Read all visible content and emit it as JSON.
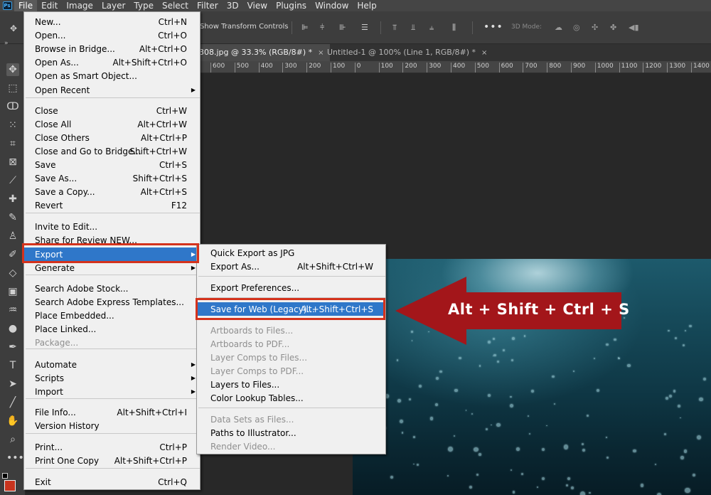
{
  "menubar": {
    "app_logo": "Ps",
    "items": [
      "File",
      "Edit",
      "Image",
      "Layer",
      "Type",
      "Select",
      "Filter",
      "3D",
      "View",
      "Plugins",
      "Window",
      "Help"
    ]
  },
  "options_bar": {
    "transform_label": "Show Transform Controls",
    "mode_3d_label": "3D Mode:",
    "more_label": "•••"
  },
  "tabs": [
    {
      "label": "308.jpg @ 33.3% (RGB/8#) *",
      "close": "×"
    },
    {
      "label": "Untitled-1 @ 100% (Line 1, RGB/8#) *",
      "close": "×"
    }
  ],
  "ruler": {
    "ticks": [
      "600",
      "500",
      "400",
      "300",
      "200",
      "100",
      "0",
      "100",
      "200",
      "300",
      "400",
      "500",
      "600",
      "700",
      "800",
      "900",
      "1000",
      "1100",
      "1200",
      "1300",
      "1400"
    ]
  },
  "file_menu": {
    "items": [
      {
        "label": "New...",
        "shortcut": "Ctrl+N"
      },
      {
        "label": "Open...",
        "shortcut": "Ctrl+O"
      },
      {
        "label": "Browse in Bridge...",
        "shortcut": "Alt+Ctrl+O"
      },
      {
        "label": "Open As...",
        "shortcut": "Alt+Shift+Ctrl+O"
      },
      {
        "label": "Open as Smart Object...",
        "shortcut": ""
      },
      {
        "label": "Open Recent",
        "shortcut": "",
        "submenu": true
      },
      {
        "label": "Close",
        "shortcut": "Ctrl+W"
      },
      {
        "label": "Close All",
        "shortcut": "Alt+Ctrl+W"
      },
      {
        "label": "Close Others",
        "shortcut": "Alt+Ctrl+P"
      },
      {
        "label": "Close and Go to Bridge...",
        "shortcut": "Shift+Ctrl+W"
      },
      {
        "label": "Save",
        "shortcut": "Ctrl+S"
      },
      {
        "label": "Save As...",
        "shortcut": "Shift+Ctrl+S"
      },
      {
        "label": "Save a Copy...",
        "shortcut": "Alt+Ctrl+S"
      },
      {
        "label": "Revert",
        "shortcut": "F12"
      },
      {
        "label": "Invite to Edit...",
        "shortcut": ""
      },
      {
        "label": "Share for Review NEW...",
        "shortcut": ""
      },
      {
        "label": "Export",
        "shortcut": "",
        "submenu": true,
        "highlighted": true
      },
      {
        "label": "Generate",
        "shortcut": "",
        "submenu": true
      },
      {
        "label": "Search Adobe Stock...",
        "shortcut": ""
      },
      {
        "label": "Search Adobe Express Templates...",
        "shortcut": ""
      },
      {
        "label": "Place Embedded...",
        "shortcut": ""
      },
      {
        "label": "Place Linked...",
        "shortcut": ""
      },
      {
        "label": "Package...",
        "shortcut": "",
        "disabled": true
      },
      {
        "label": "Automate",
        "shortcut": "",
        "submenu": true
      },
      {
        "label": "Scripts",
        "shortcut": "",
        "submenu": true
      },
      {
        "label": "Import",
        "shortcut": "",
        "submenu": true
      },
      {
        "label": "File Info...",
        "shortcut": "Alt+Shift+Ctrl+I"
      },
      {
        "label": "Version History",
        "shortcut": ""
      },
      {
        "label": "Print...",
        "shortcut": "Ctrl+P"
      },
      {
        "label": "Print One Copy",
        "shortcut": "Alt+Shift+Ctrl+P"
      },
      {
        "label": "Exit",
        "shortcut": "Ctrl+Q"
      }
    ]
  },
  "export_menu": {
    "items": [
      {
        "label": "Quick Export as JPG",
        "shortcut": ""
      },
      {
        "label": "Export As...",
        "shortcut": "Alt+Shift+Ctrl+W"
      },
      {
        "label": "Export Preferences...",
        "shortcut": ""
      },
      {
        "label": "Save for Web (Legacy)...",
        "shortcut": "Alt+Shift+Ctrl+S",
        "highlighted": true
      },
      {
        "label": "Artboards to Files...",
        "shortcut": "",
        "disabled": true
      },
      {
        "label": "Artboards to PDF...",
        "shortcut": "",
        "disabled": true
      },
      {
        "label": "Layer Comps to Files...",
        "shortcut": "",
        "disabled": true
      },
      {
        "label": "Layer Comps to PDF...",
        "shortcut": "",
        "disabled": true
      },
      {
        "label": "Layers to Files...",
        "shortcut": ""
      },
      {
        "label": "Color Lookup Tables...",
        "shortcut": ""
      },
      {
        "label": "Data Sets as Files...",
        "shortcut": "",
        "disabled": true
      },
      {
        "label": "Paths to Illustrator...",
        "shortcut": ""
      },
      {
        "label": "Render Video...",
        "shortcut": "",
        "disabled": true
      }
    ]
  },
  "annotation": {
    "text": "Alt + Shift + Ctrl + S",
    "color": "#a3161a"
  },
  "colors": {
    "highlight": "#2f77c9",
    "redbox": "#d4321c",
    "foreground_swatch": "#c8341e"
  }
}
